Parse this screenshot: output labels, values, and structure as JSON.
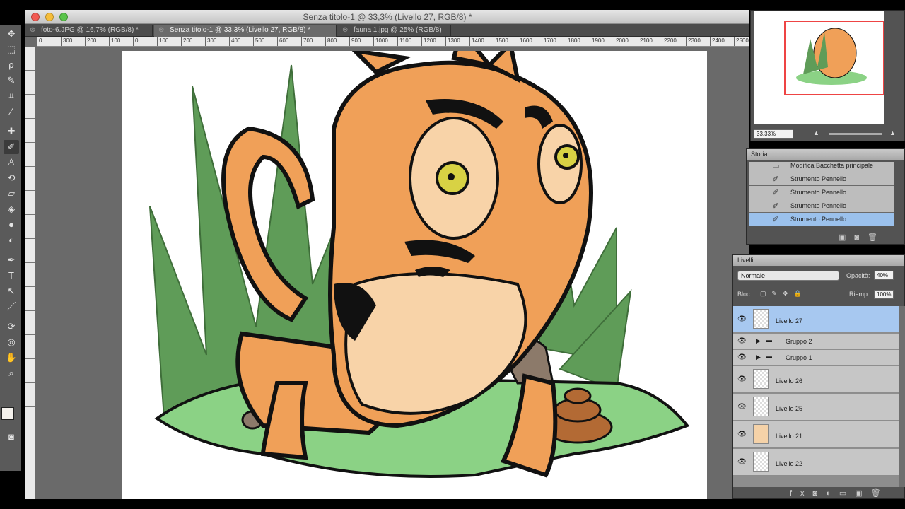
{
  "window": {
    "title": "Senza titolo-1 @ 33,3% (Livello 27, RGB/8) *"
  },
  "tabs": [
    {
      "label": "foto-6.JPG @ 16,7% (RGB/8) *"
    },
    {
      "label": "Senza titolo-1 @ 33,3% (Livello 27, RGB/8) *"
    },
    {
      "label": "fauna 1.jpg @ 25% (RGB/8)"
    }
  ],
  "ruler": {
    "ticks": [
      "0",
      "300",
      "200",
      "100",
      "0",
      "100",
      "200",
      "300",
      "400",
      "500",
      "600",
      "700",
      "800",
      "900",
      "1000",
      "1100",
      "1200",
      "1300",
      "1400",
      "1500",
      "1600",
      "1700",
      "1800",
      "1900",
      "2000",
      "2100",
      "2200",
      "2300",
      "2400",
      "2500"
    ]
  },
  "navigator": {
    "zoom": "33,33%"
  },
  "history": {
    "title": "Storia",
    "items": [
      "Modifica Bacchetta principale",
      "Strumento Pennello",
      "Strumento Pennello",
      "Strumento Pennello",
      "Strumento Pennello"
    ]
  },
  "layers": {
    "title": "Livelli",
    "blend_mode": "Normale",
    "opacity_label": "Opacità:",
    "opacity": "40%",
    "lock_label": "Bloc.:",
    "fill_label": "Riemp.:",
    "fill": "100%",
    "items": [
      {
        "name": "Livello 27"
      },
      {
        "name": "Gruppo 2"
      },
      {
        "name": "Gruppo 1"
      },
      {
        "name": "Livello 26"
      },
      {
        "name": "Livello 25"
      },
      {
        "name": "Livello 21"
      },
      {
        "name": "Livello 22"
      }
    ]
  },
  "colors": {
    "foreground": "#f4f1ec",
    "background": "#e8c4ac",
    "selection": "#a7c8f0"
  }
}
